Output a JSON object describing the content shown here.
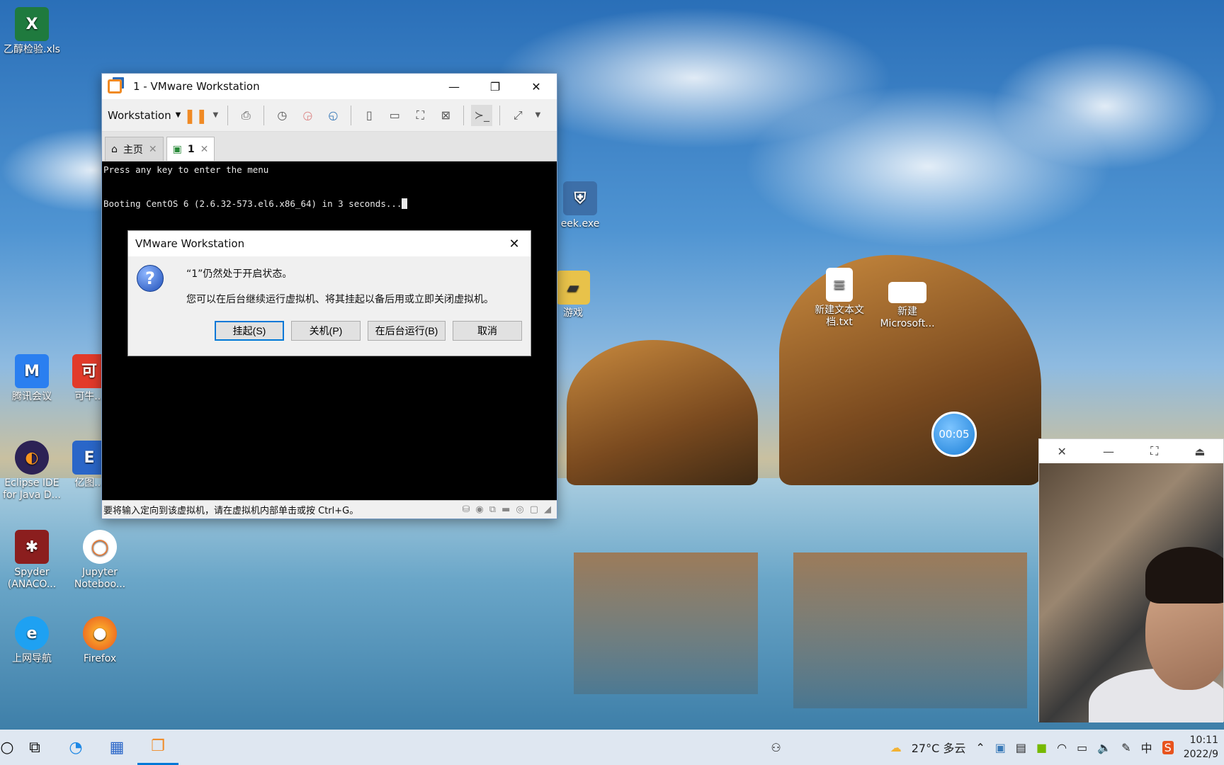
{
  "desktop": {
    "icons": [
      {
        "name": "乙醇检验.xls"
      },
      {
        "name": "腾讯会议"
      },
      {
        "name": "可牛..."
      },
      {
        "name": "Eclipse IDE for Java D..."
      },
      {
        "name": "亿图..."
      },
      {
        "name": "Spyder (ANACO..."
      },
      {
        "name": "Jupyter Noteboo..."
      },
      {
        "name": "上网导航"
      },
      {
        "name": "Firefox"
      },
      {
        "name": "eek.exe"
      },
      {
        "name": "游戏"
      },
      {
        "name": "新建文本文档.txt"
      },
      {
        "name": "新建 Microsoft..."
      }
    ]
  },
  "vmware": {
    "title": "1 - VMware Workstation",
    "menu_label": "Workstation",
    "tabs": [
      {
        "label": "主页"
      },
      {
        "label": "1"
      }
    ],
    "console": {
      "line1": "Press any key to enter the menu",
      "line2": "Booting CentOS 6 (2.6.32-573.el6.x86_64) in 3 seconds..."
    },
    "status": "要将输入定向到该虚拟机，请在虚拟机内部单击或按 Ctrl+G。"
  },
  "dialog": {
    "title": "VMware Workstation",
    "message1": "“1”仍然处于开启状态。",
    "message2": "您可以在后台继续运行虚拟机、将其挂起以备后用或立即关闭虚拟机。",
    "buttons": {
      "suspend": "挂起(S)",
      "shutdown": "关机(P)",
      "background": "在后台运行(B)",
      "cancel": "取消"
    }
  },
  "timer": "00:05",
  "taskbar": {
    "weather": "27°C 多云",
    "time": "10:11",
    "date": "2022/9"
  },
  "colors": {
    "accent": "#0078d7",
    "vm_orange": "#f08a24"
  }
}
